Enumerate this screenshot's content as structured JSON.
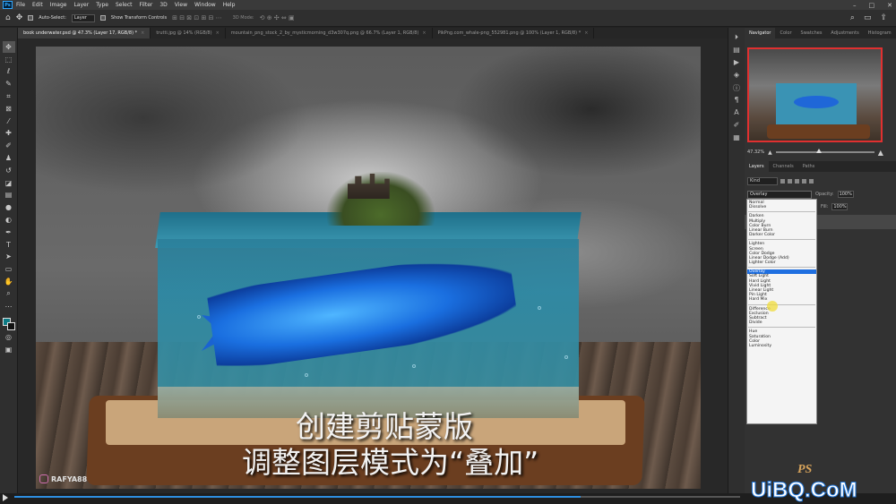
{
  "menubar": {
    "logo": "Ps",
    "items": [
      "File",
      "Edit",
      "Image",
      "Layer",
      "Type",
      "Select",
      "Filter",
      "3D",
      "View",
      "Window",
      "Help"
    ]
  },
  "options": {
    "auto_select": "Auto-Select:",
    "layer_select": "Layer",
    "show_transform": "Show Transform Controls",
    "mode_3d": "3D Mode:"
  },
  "tabs": [
    {
      "label": "book underwater.psd @ 47.3% (Layer 17, RGB/8) *",
      "active": true
    },
    {
      "label": "trutti.jpg @ 14% (RGB/8)",
      "active": false
    },
    {
      "label": "mountain_png_stock_2_by_mysticmorning_d3w307q.png @ 66.7% (Layer 1, RGB/8)",
      "active": false
    },
    {
      "label": "PikPng.com_whale-png_552981.png @ 100% (Layer 1, RGB/8) *",
      "active": false
    }
  ],
  "caption": {
    "line1": "创建剪贴蒙版",
    "line2": "调整图层模式为“叠加”"
  },
  "watermark": "RAFYA88",
  "right_panel": {
    "nav_tabs": [
      "Navigator",
      "Color",
      "Swatches",
      "Adjustments",
      "Histogram"
    ],
    "zoom": "47.32%",
    "layers_tabs": [
      "Layers",
      "Channels",
      "Paths"
    ],
    "kind": "Kind",
    "blend_mode": "Overlay",
    "opacity_label": "Opacity:",
    "opacity_value": "100%",
    "fill_label": "Fill:",
    "fill_value": "100%"
  },
  "blend_menu": [
    [
      "Normal",
      "Dissolve"
    ],
    [
      "Darken",
      "Multiply",
      "Color Burn",
      "Linear Burn",
      "Darker Color"
    ],
    [
      "Lighten",
      "Screen",
      "Color Dodge",
      "Linear Dodge (Add)",
      "Lighter Color"
    ],
    [
      "Overlay",
      "Soft Light",
      "Hard Light",
      "Vivid Light",
      "Linear Light",
      "Pin Light",
      "Hard Mix"
    ],
    [
      "Difference",
      "Exclusion",
      "Subtract",
      "Divide"
    ],
    [
      "Hue",
      "Saturation",
      "Color",
      "Luminosity"
    ]
  ],
  "blend_selected": "Overlay",
  "video_progress": 0.78,
  "brand": {
    "site": "UiBQ.CoM",
    "ps": "PS"
  },
  "colors": {
    "accent": "#1f6fe0",
    "foreground": "#0c7a84",
    "background": "#111111"
  }
}
